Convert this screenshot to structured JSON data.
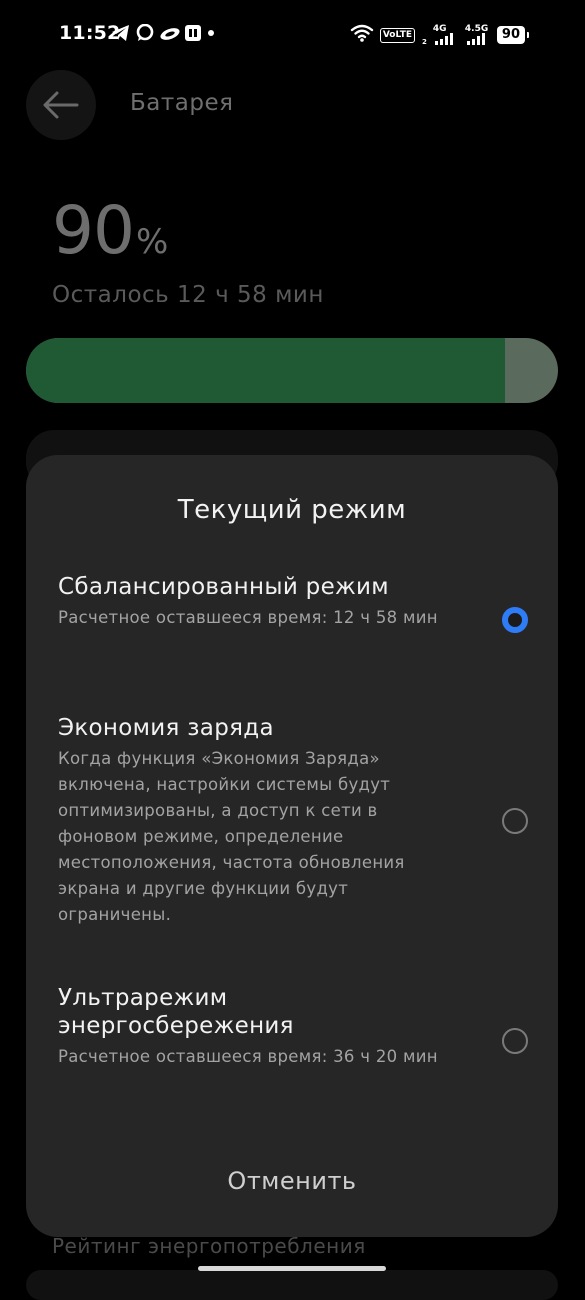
{
  "status_bar": {
    "time": "11:52",
    "volte": "VoLTE",
    "volte_sub": "2",
    "net1": "4G",
    "net2": "4.5G",
    "battery": "90"
  },
  "header": {
    "title": "Батарея"
  },
  "battery": {
    "percent": "90",
    "percent_sign": "%",
    "remaining": "Осталось 12 ч 58 мин",
    "level": 0.9
  },
  "dialog": {
    "title": "Текущий режим",
    "options": [
      {
        "title": "Сбалансированный режим",
        "desc": "Расчетное оставшееся время: 12 ч 58 мин",
        "selected": true
      },
      {
        "title": "Экономия заряда",
        "desc": "Когда функция «Экономия Заряда» включена, настройки системы будут оптимизированы, а доступ к сети в фоновом режиме, определение местоположения, частота обновления экрана и другие функции будут ограничены.",
        "selected": false
      },
      {
        "title": "Ультрарежим энергосбережения",
        "desc": "Расчетное оставшееся время: 36 ч 20 мин",
        "selected": false
      }
    ],
    "cancel_label": "Отменить"
  },
  "background": {
    "section_label": "Рейтинг энергопотребления"
  },
  "colors": {
    "accent": "#2e7cf6",
    "battery_green": "#1f5a35"
  }
}
